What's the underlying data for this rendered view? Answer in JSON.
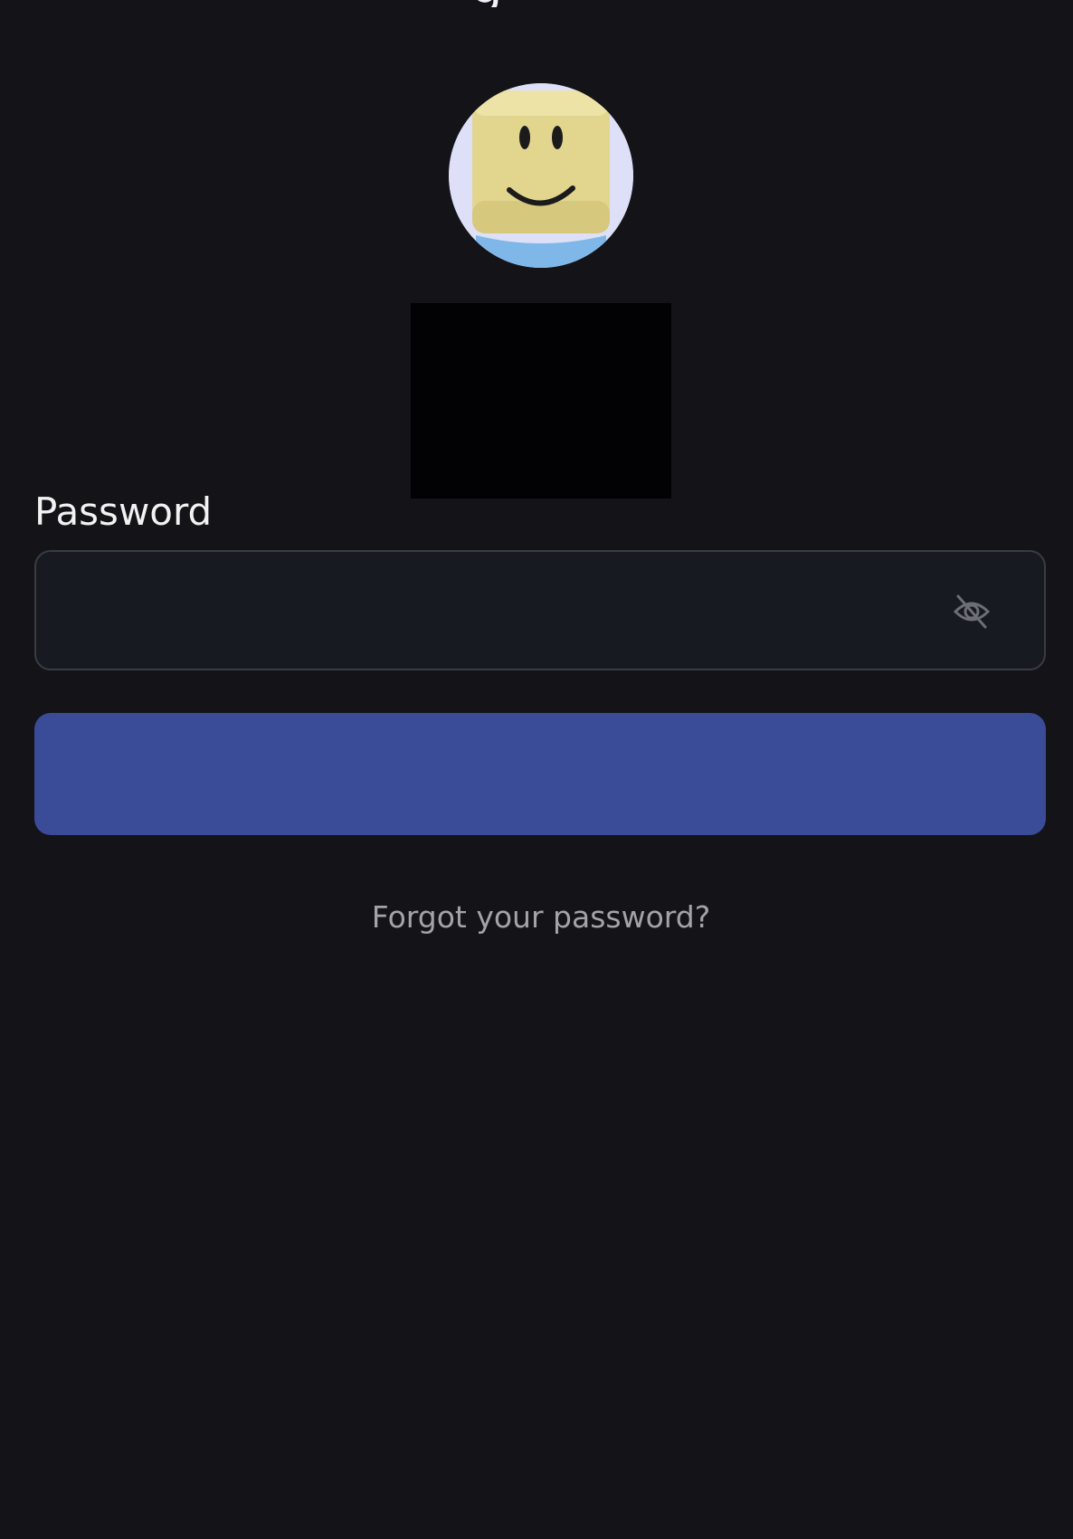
{
  "header": {
    "title_fragment": "g"
  },
  "avatar": {
    "icon": "smiley-avatar-icon"
  },
  "password": {
    "label": "Password",
    "value": "",
    "placeholder": "",
    "toggle_icon": "eye-off-icon"
  },
  "login_button": {
    "label": ""
  },
  "forgot_link": {
    "label": "Forgot your password?"
  },
  "colors": {
    "background": "#131318",
    "field_background": "#181a22",
    "field_border": "#3b3c43",
    "button": "#3a4b98",
    "muted_text": "#a3a3a8"
  }
}
